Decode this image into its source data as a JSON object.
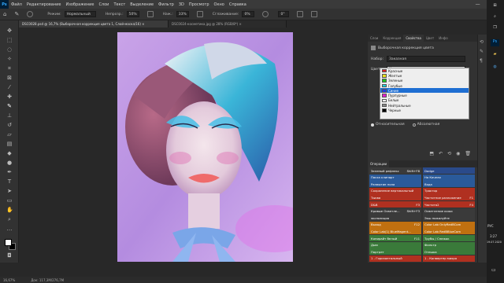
{
  "menu": [
    "Файл",
    "Редактирование",
    "Изображение",
    "Слои",
    "Текст",
    "Выделение",
    "Фильтр",
    "3D",
    "Просмотр",
    "Окно",
    "Справка"
  ],
  "app_logo": "Ps",
  "options": {
    "mode_label": "Режим:",
    "mode_value": "Нормальный",
    "opacity_label": "Непрозр.:",
    "opacity_value": "50%",
    "flow_label": "Наж.:",
    "flow_value": "33%",
    "smoothing_label": "Сглаживание:",
    "smoothing_value": "0%",
    "angle_value": "0°"
  },
  "tabs": [
    {
      "label": "DSC0028.psd @ 16,7% (Выборочная коррекция цвета 1, Слой-маска/16) ×",
      "active": true
    },
    {
      "label": "DSC0024-косметика.jpg @ 28% (RGB/8*) ×",
      "active": false
    }
  ],
  "panel_tabs": [
    "Слои",
    "Коррекция",
    "Свойства",
    "Цвет",
    "Инфо"
  ],
  "properties": {
    "title": "Выборочная коррекция цвета",
    "preset_label": "Набор:",
    "preset_value": "Заказная",
    "colors_label": "Цвета:",
    "colors_value": "Красные",
    "relative": "Относительная",
    "absolute": "Абсолютная"
  },
  "dropdown": [
    {
      "label": "Красные",
      "color": "#e02020",
      "selected": false
    },
    {
      "label": "Желтые",
      "color": "#e8e020",
      "selected": false
    },
    {
      "label": "Зеленые",
      "color": "#20c020",
      "selected": false
    },
    {
      "label": "Голубые",
      "color": "#20d0e0",
      "selected": false
    },
    {
      "label": "Синие",
      "color": "#2040e0",
      "selected": true
    },
    {
      "label": "Пурпурные",
      "color": "#e020d0",
      "selected": false
    },
    {
      "label": "Белые",
      "color": "#ffffff",
      "selected": false
    },
    {
      "label": "Нейтральные",
      "color": "#888888",
      "selected": false
    },
    {
      "label": "Черные",
      "color": "#000000",
      "selected": false
    }
  ],
  "operations_title": "Операции",
  "operations": [
    {
      "left": "Зеленый рефлекс",
      "lkey": "Shift+F8",
      "lcol": "#3a3a3a",
      "right": "Dodge",
      "rcol": "#2a4a8a"
    },
    {
      "left": "Пасха клипарт",
      "lkey": "",
      "lcol": "#2a5a9a",
      "right": "На Качели",
      "rcol": "#2a5a9a"
    },
    {
      "left": "Размытие пола",
      "lkey": "",
      "lcol": "#2a5a9a",
      "right": "Вода",
      "rcol": "#2a5a9a"
    },
    {
      "left": "Сохранение вертикальный",
      "lkey": "",
      "lcol": "#b03020",
      "right": "Трактор",
      "rcol": "#b03020"
    },
    {
      "left": "Тыква",
      "lkey": "",
      "lcol": "#b03020",
      "right": "Частотное разложение",
      "rkey": "F1",
      "rcol": "#b03020"
    },
    {
      "left": "D&B",
      "lkey": "F3",
      "lcol": "#b03020",
      "right": "Частота2",
      "rkey": "F4",
      "rcol": "#b03020"
    },
    {
      "left": "Кривые Осветле...",
      "lkey": "Shift+F3",
      "lcol": "#3a3a3a",
      "right": "Осветление кожи",
      "rcol": "#3a3a3a"
    },
    {
      "left": "экспозиция",
      "lkey": "",
      "lcol": "#3a3a3a",
      "right": "Экш пожалуйте",
      "rcol": "#3a3a3a"
    },
    {
      "left": "Выход",
      "lkey": "F12",
      "lcol": "#c07010",
      "right": "Color Lab OnlyRedBCom",
      "rcol": "#c07010"
    },
    {
      "left": "Color Lab(1) BlueMagent...",
      "lkey": "",
      "lcol": "#c07010",
      "right": "Color Lab RedBBlueCom",
      "rcol": "#c07010"
    },
    {
      "left": "Копирайт белый",
      "lkey": "F11",
      "lcol": "#3a7a3a",
      "right": "Трубы / Снежок",
      "rcol": "#3a7a3a"
    },
    {
      "left": "Дым",
      "lkey": "",
      "lcol": "#3a7a3a",
      "right": "Фильтр",
      "rcol": "#3a7a3a"
    },
    {
      "left": "Портрет",
      "lkey": "",
      "lcol": "#3a7a3a",
      "right": "Отешка",
      "rcol": "#3a7a3a"
    },
    {
      "left": "1 - Горизонтальный",
      "lkey": "",
      "lcol": "#b03020",
      "right": "1 - Конвертер михро",
      "rcol": "#b03020"
    }
  ],
  "status": {
    "zoom": "16,67%",
    "doc": "Док: 117,3M/276,7M"
  },
  "taskbar": {
    "lang": "РУС",
    "time": "3:27",
    "date": "19.07.2020"
  }
}
